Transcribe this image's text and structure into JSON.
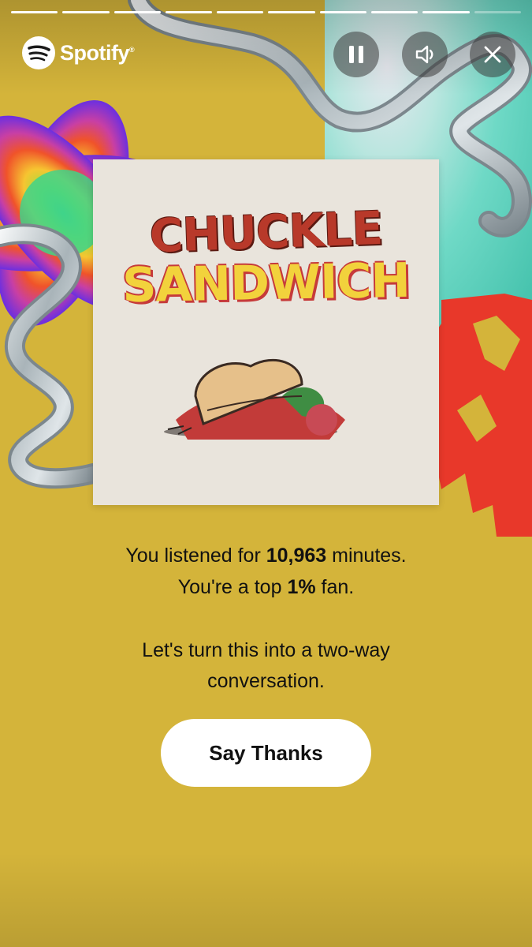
{
  "story": {
    "segments_done": 9,
    "segments_total": 10
  },
  "header": {
    "brand": "Spotify",
    "brand_mark": "®",
    "icons": [
      "spotify-logo-icon",
      "pause-icon",
      "volume-icon",
      "close-icon"
    ]
  },
  "album": {
    "title_line1": "CHUCKLE",
    "title_line2": "SANDWICH"
  },
  "message": {
    "listened_prefix": "You listened for ",
    "minutes": "10,963",
    "listened_suffix": " minutes.",
    "fan_prefix": "You're a top ",
    "fan_percent": "1%",
    "fan_suffix": " fan.",
    "invite_line1": "Let's turn this into a two-way",
    "invite_line2": "conversation."
  },
  "cta": {
    "label": "Say Thanks"
  },
  "colors": {
    "background": "#d4b43a",
    "button": "#ffffff",
    "text": "#111111"
  }
}
